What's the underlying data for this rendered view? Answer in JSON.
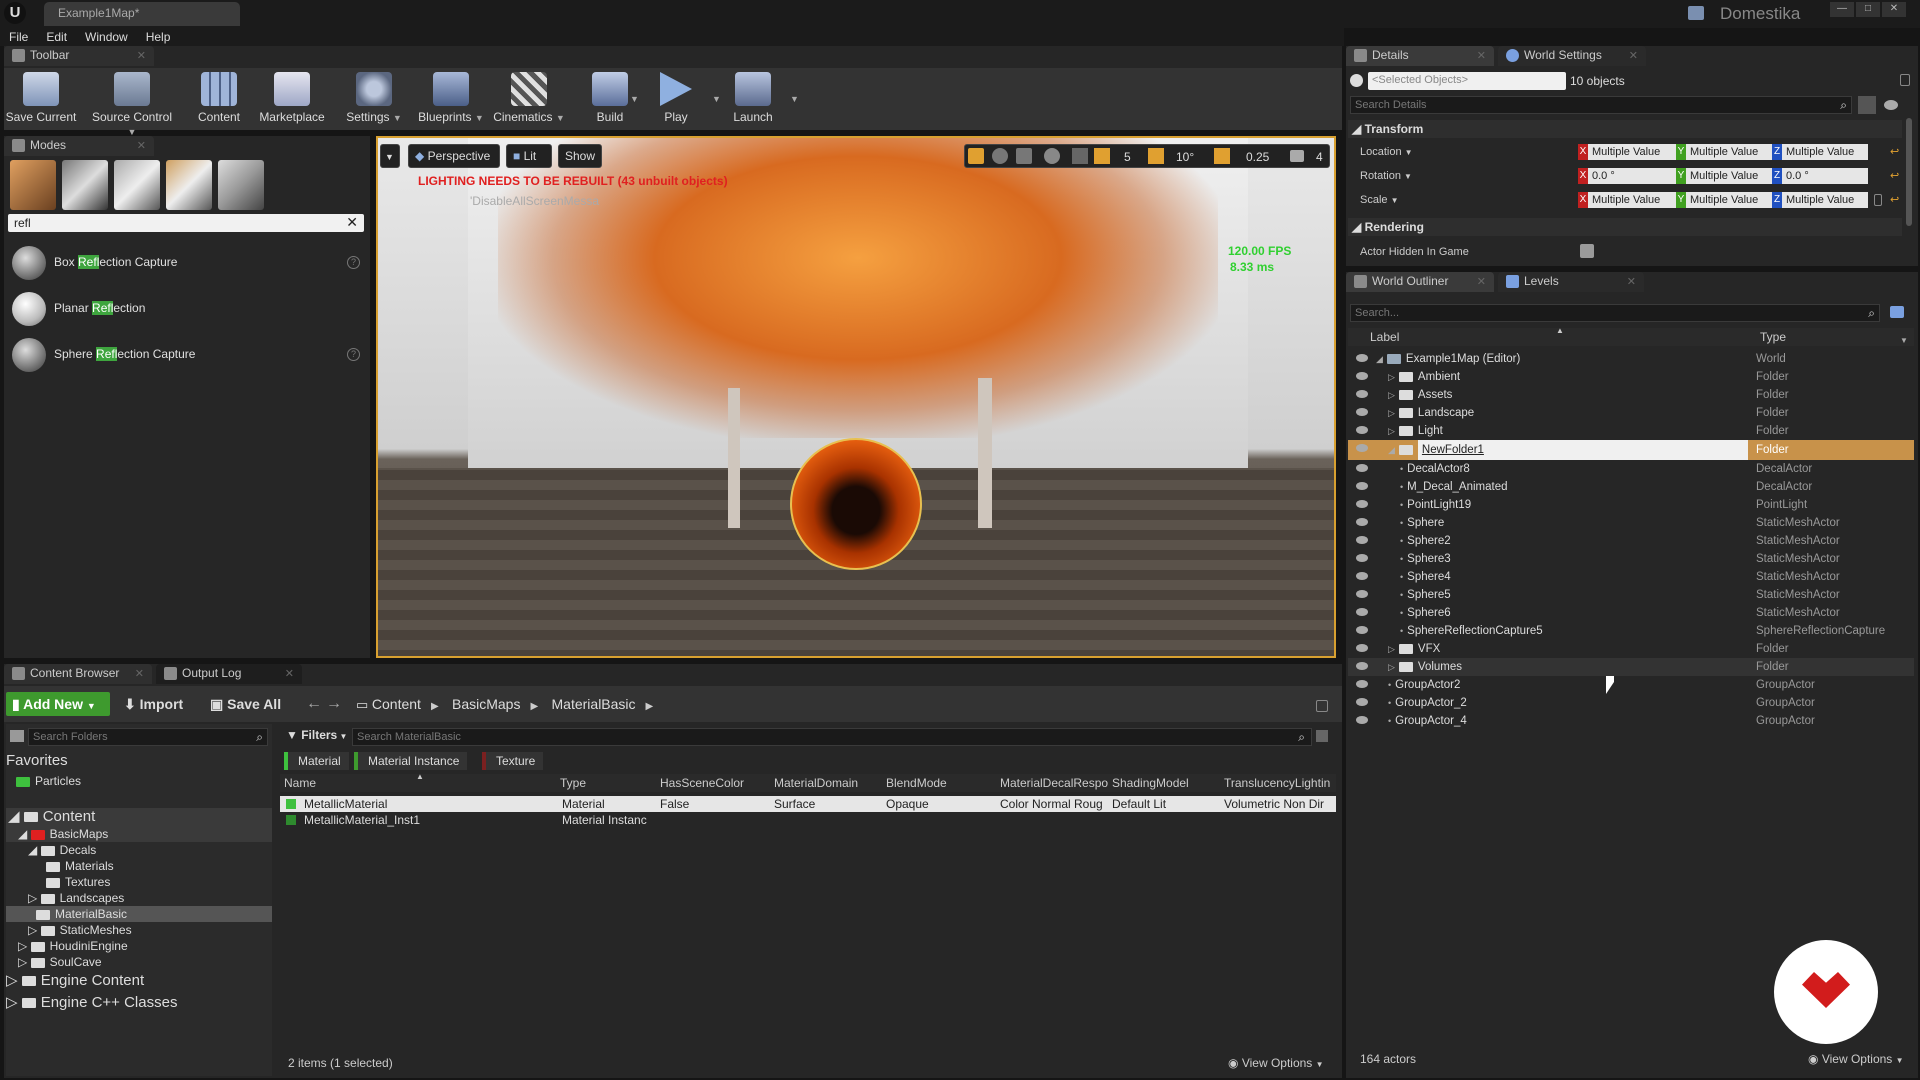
{
  "window": {
    "tab_title": "Example1Map*",
    "brand": "Domestika"
  },
  "menu": [
    "File",
    "Edit",
    "Window",
    "Help"
  ],
  "toolbar": {
    "tab": "Toolbar",
    "buttons": [
      "Save Current",
      "Source Control",
      "Content",
      "Marketplace",
      "Settings",
      "Blueprints",
      "Cinematics",
      "Build",
      "Play",
      "Launch"
    ]
  },
  "modes": {
    "tab": "Modes",
    "search": "refl",
    "items": [
      {
        "pre": "Box ",
        "hl": "Refl",
        "post": "ection Capture"
      },
      {
        "pre": "Planar ",
        "hl": "Refl",
        "post": "ection"
      },
      {
        "pre": "Sphere ",
        "hl": "Refl",
        "post": "ection Capture"
      }
    ]
  },
  "viewport": {
    "perspective": "Perspective",
    "lit": "Lit",
    "show": "Show",
    "warning": "LIGHTING NEEDS TO BE REBUILT (43 unbuilt objects)",
    "sub_warning": "'DisableAllScreenMessa",
    "fps": "120.00 FPS",
    "ms": "8.33 ms",
    "grid": "5",
    "angle": "10°",
    "scale": "0.25",
    "cam": "4"
  },
  "details": {
    "tabs": [
      "Details",
      "World Settings"
    ],
    "selected": "<Selected Objects>",
    "count": "10 objects",
    "search_ph": "Search Details",
    "transform": "Transform",
    "rendering": "Rendering",
    "location": "Location",
    "rotation": "Rotation",
    "scale": "Scale",
    "multiple": "Multiple Value",
    "zero": "0.0 °",
    "hidden": "Actor Hidden In Game"
  },
  "outliner": {
    "tabs": [
      "World Outliner",
      "Levels"
    ],
    "search_ph": "Search...",
    "col_label": "Label",
    "col_type": "Type",
    "footer": "164 actors",
    "view_options": "View Options",
    "rows": [
      {
        "label": "Example1Map (Editor)",
        "type": "World",
        "indent": 0
      },
      {
        "label": "Ambient",
        "type": "Folder",
        "indent": 1
      },
      {
        "label": "Assets",
        "type": "Folder",
        "indent": 1
      },
      {
        "label": "Landscape",
        "type": "Folder",
        "indent": 1
      },
      {
        "label": "Light",
        "type": "Folder",
        "indent": 1
      },
      {
        "label": "NewFolder1",
        "type": "Folder",
        "indent": 1,
        "selected": true
      },
      {
        "label": "DecalActor8",
        "type": "DecalActor",
        "indent": 2
      },
      {
        "label": "M_Decal_Animated",
        "type": "DecalActor",
        "indent": 2
      },
      {
        "label": "PointLight19",
        "type": "PointLight",
        "indent": 2
      },
      {
        "label": "Sphere",
        "type": "StaticMeshActor",
        "indent": 2
      },
      {
        "label": "Sphere2",
        "type": "StaticMeshActor",
        "indent": 2
      },
      {
        "label": "Sphere3",
        "type": "StaticMeshActor",
        "indent": 2
      },
      {
        "label": "Sphere4",
        "type": "StaticMeshActor",
        "indent": 2
      },
      {
        "label": "Sphere5",
        "type": "StaticMeshActor",
        "indent": 2
      },
      {
        "label": "Sphere6",
        "type": "StaticMeshActor",
        "indent": 2
      },
      {
        "label": "SphereReflectionCapture5",
        "type": "SphereReflectionCapture",
        "indent": 2
      },
      {
        "label": "VFX",
        "type": "Folder",
        "indent": 1
      },
      {
        "label": "Volumes",
        "type": "Folder",
        "indent": 1
      },
      {
        "label": "GroupActor2",
        "type": "GroupActor",
        "indent": 1
      },
      {
        "label": "GroupActor_2",
        "type": "GroupActor",
        "indent": 1
      },
      {
        "label": "GroupActor_4",
        "type": "GroupActor",
        "indent": 1
      }
    ]
  },
  "content": {
    "tabs": [
      "Content Browser",
      "Output Log"
    ],
    "add_new": "Add New",
    "import": "Import",
    "save_all": "Save All",
    "crumbs": [
      "Content",
      "BasicMaps",
      "MaterialBasic"
    ],
    "search_folders": "Search Folders",
    "favorites": "Favorites",
    "fav_item": "Particles",
    "filters": "Filters",
    "search_assets": "Search MaterialBasic",
    "chips": [
      "Material",
      "Material Instance",
      "Texture"
    ],
    "columns": [
      "Name",
      "Type",
      "HasSceneColor",
      "MaterialDomain",
      "BlendMode",
      "MaterialDecalRespo",
      "ShadingModel",
      "TranslucencyLightin"
    ],
    "assets": [
      [
        "MetallicMaterial",
        "Material",
        "False",
        "Surface",
        "Opaque",
        "Color Normal Roug",
        "Default Lit",
        "Volumetric Non Dir"
      ],
      [
        "MetallicMaterial_Inst1",
        "Material Instanc",
        "",
        "",
        "",
        "",
        "",
        ""
      ]
    ],
    "status": "2 items (1 selected)",
    "view_options": "View Options",
    "tree": [
      {
        "t": "Content",
        "l": 0,
        "big": true
      },
      {
        "t": "BasicMaps",
        "l": 1
      },
      {
        "t": "Decals",
        "l": 2
      },
      {
        "t": "Materials",
        "l": 3
      },
      {
        "t": "Textures",
        "l": 3
      },
      {
        "t": "Landscapes",
        "l": 2
      },
      {
        "t": "MaterialBasic",
        "l": 2,
        "sel": true
      },
      {
        "t": "StaticMeshes",
        "l": 2
      },
      {
        "t": "HoudiniEngine",
        "l": 1
      },
      {
        "t": "SoulCave",
        "l": 1
      },
      {
        "t": "Engine Content",
        "l": 0,
        "big": true
      },
      {
        "t": "Engine C++ Classes",
        "l": 0,
        "big": true
      }
    ]
  }
}
